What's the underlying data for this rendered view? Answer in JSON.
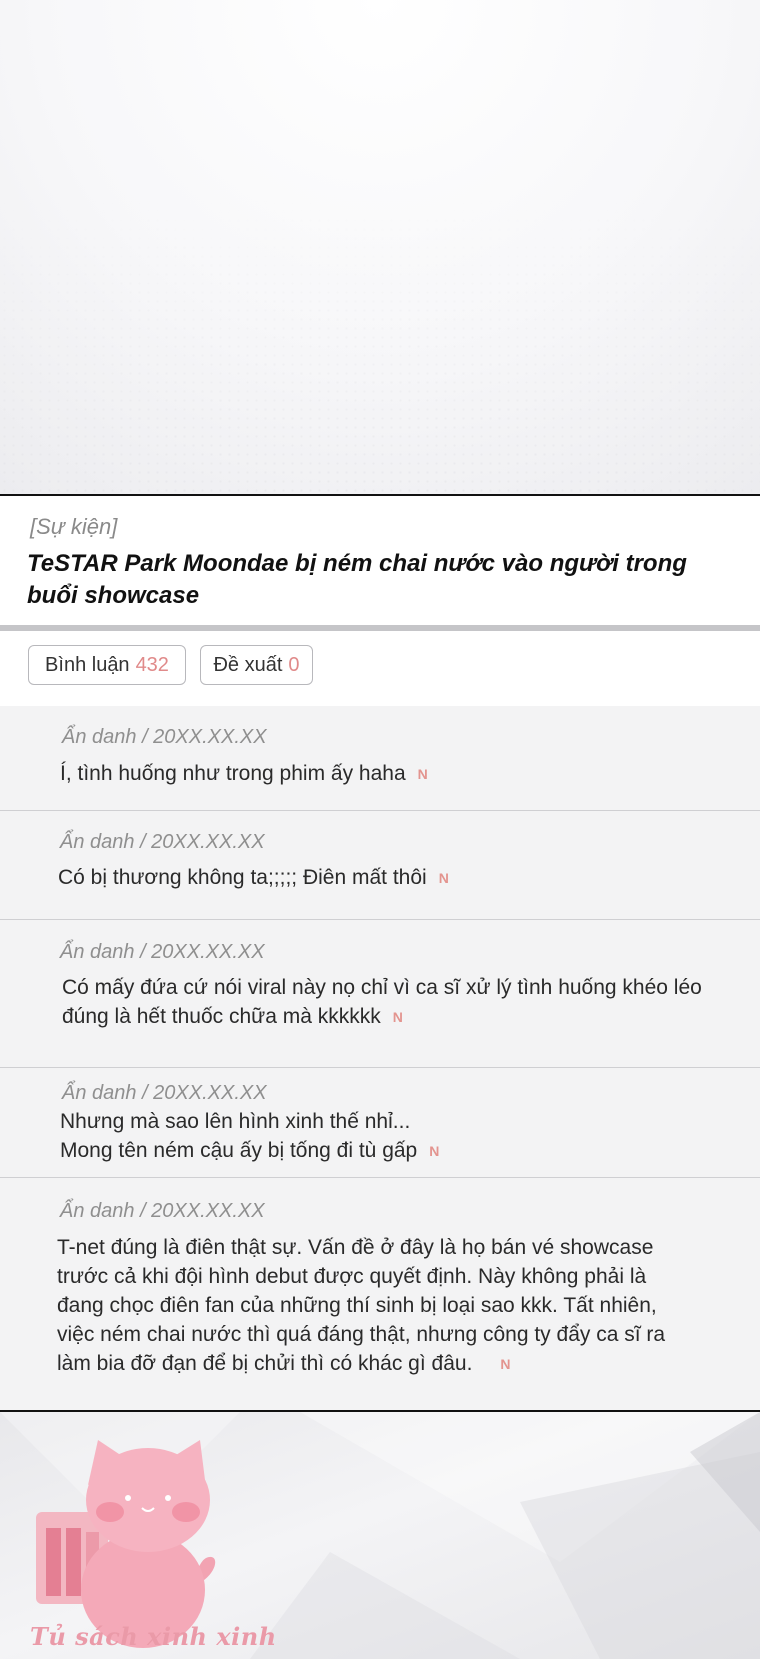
{
  "post": {
    "tag": "[Sự kiện]",
    "title": "TeSTAR Park Moondae bị ném chai nước vào người trong buổi showcase"
  },
  "tabs": {
    "comments_label": "Bình luận",
    "comments_count": "432",
    "suggest_label": "Đề xuất",
    "suggest_count": "0"
  },
  "comments": [
    {
      "meta": "Ẩn danh  / 20XX.XX.XX",
      "text": "Í, tình huống như trong phim ấy haha",
      "new": "N"
    },
    {
      "meta": "Ẩn danh  / 20XX.XX.XX",
      "text": "Có bị thương không ta;;;;; Điên mất thôi",
      "new": "N"
    },
    {
      "meta": "Ẩn danh  / 20XX.XX.XX",
      "text": "Có mấy đứa cứ nói viral này nọ chỉ vì ca sĩ xử lý tình huống khéo léo\nđúng là hết thuốc chữa mà kkkkkk",
      "new": "N"
    },
    {
      "meta": "Ẩn danh  / 20XX.XX.XX",
      "text": "Nhưng mà sao lên hình xinh thế nhỉ...\nMong tên ném cậu ấy bị tống đi tù gấp",
      "new": "N"
    },
    {
      "meta": "Ẩn danh  / 20XX.XX.XX",
      "text": "T-net đúng là điên thật sự. Vấn đề ở đây là họ bán vé showcase\ntrước cả khi đội hình debut được quyết định. Này không phải là\nđang chọc điên fan của những thí sinh bị loại sao kkk. Tất nhiên,\nviệc ném chai nước thì quá đáng thật, nhưng công ty đẩy ca sĩ ra\nlàm bia đỡ đạn để bị chửi thì có khác gì đâu.",
      "new": "N"
    }
  ],
  "watermark": {
    "text": "Tủ sách xinh xinh",
    "icon": "pink-cat-bookshelf-logo"
  },
  "colors": {
    "accent": "#e08a8a",
    "new_mark": "#e3948f",
    "logo_pink": "#ea9aa8"
  }
}
